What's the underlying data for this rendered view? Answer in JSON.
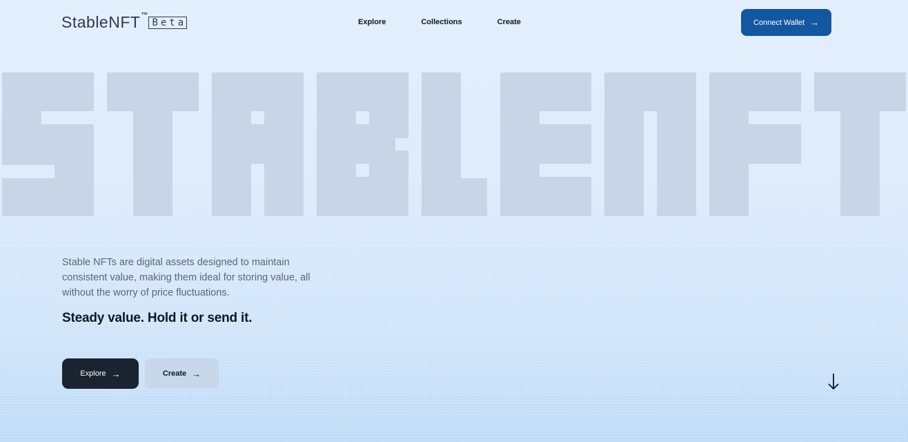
{
  "header": {
    "logo_text": "StableNFT",
    "logo_tm": "™",
    "logo_badge": "Beta",
    "nav": [
      "Explore",
      "Collections",
      "Create"
    ],
    "connect_label": "Connect Wallet",
    "connect_icon": "arrow-right-icon"
  },
  "hero": {
    "big_title": "STABLENFT",
    "big_title_color": "#c7d5e6",
    "description": "Stable NFTs are digital assets designed to maintain consistent value, making them ideal for storing value, all without the worry of price fluctuations.",
    "tagline": "Steady value. Hold it or send it.",
    "explore_label": "Explore",
    "create_label": "Create",
    "button_icon": "arrow-right-icon",
    "scroll_icon": "arrow-down-icon"
  },
  "colors": {
    "accent": "#1457a1",
    "dark_button": "#1a2330",
    "light_button": "#c9d7ea"
  }
}
